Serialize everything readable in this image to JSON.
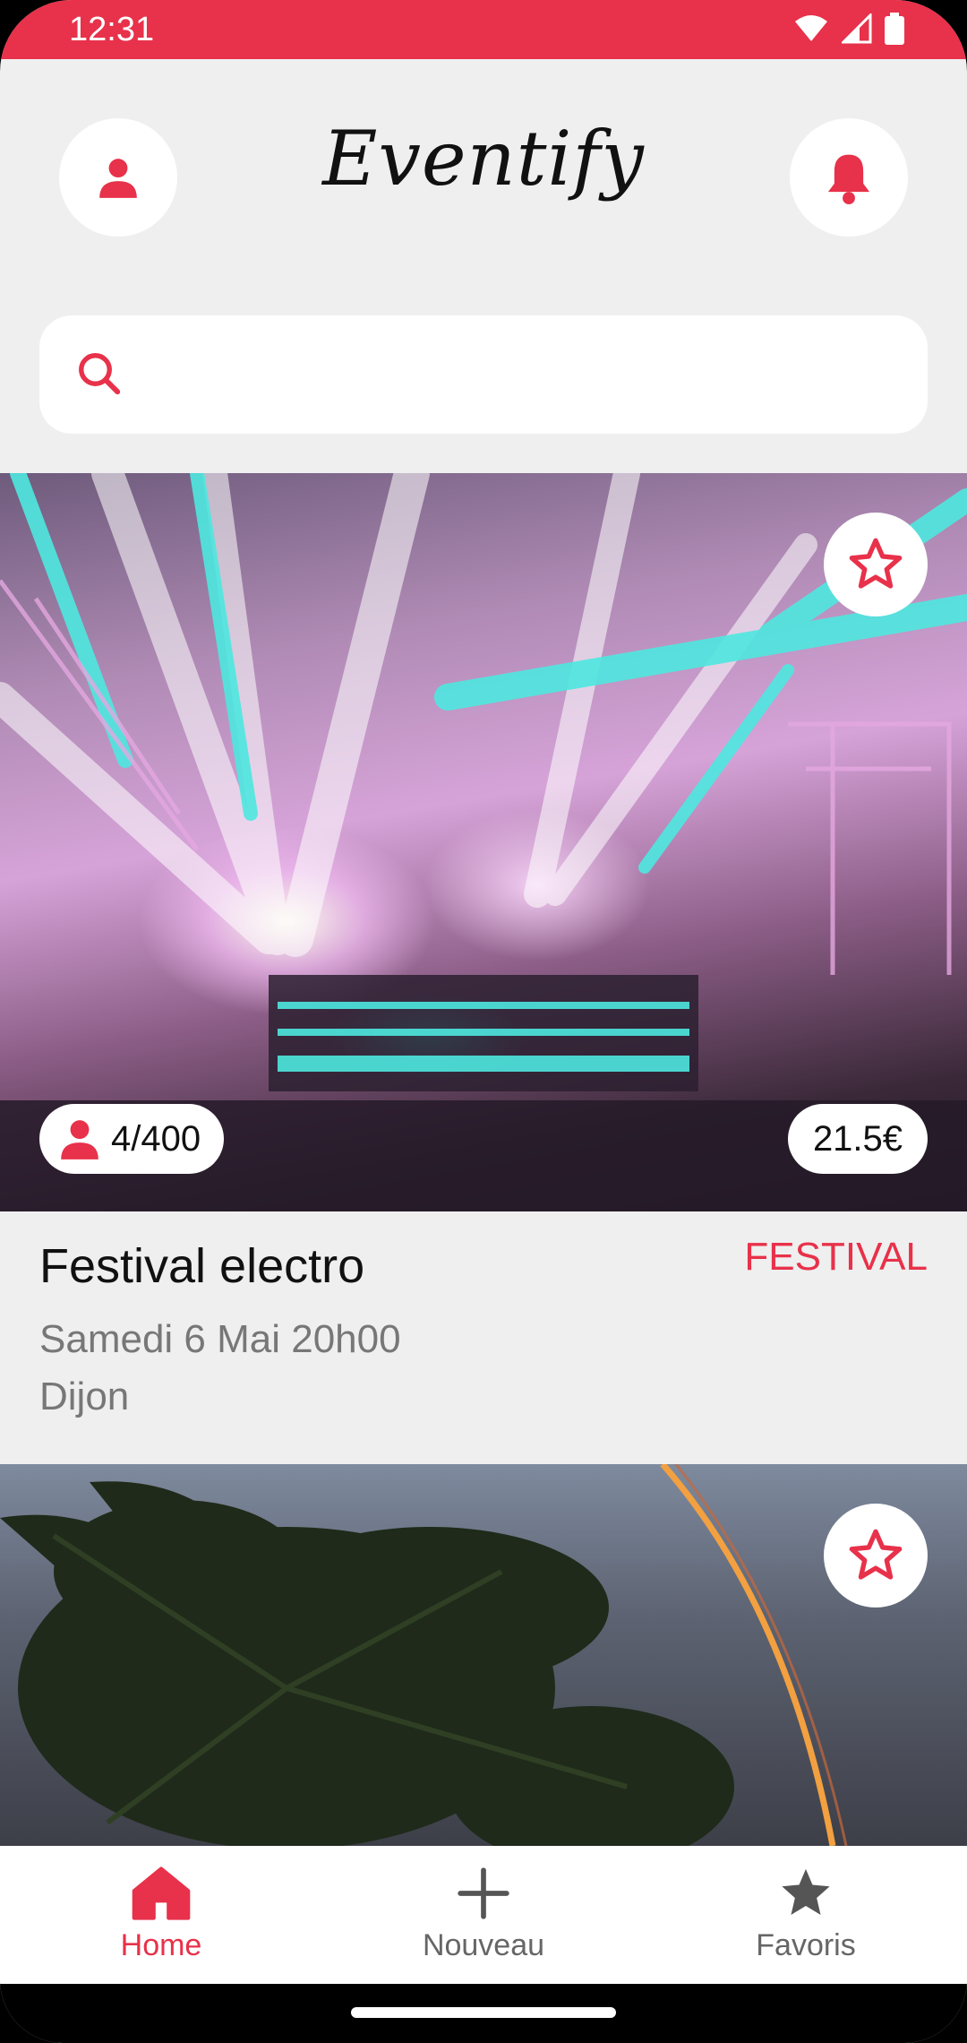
{
  "status_bar": {
    "time": "12:31"
  },
  "header": {
    "app_name": "Eventify"
  },
  "search": {
    "placeholder": ""
  },
  "events": [
    {
      "attendees": "4/400",
      "price": "21.5€",
      "title": "Festival electro",
      "category": "FESTIVAL",
      "date": "Samedi 6 Mai 20h00",
      "city": "Dijon"
    }
  ],
  "bottom_nav": [
    {
      "label": "Home",
      "icon": "home-icon",
      "active": true
    },
    {
      "label": "Nouveau",
      "icon": "plus-icon",
      "active": false
    },
    {
      "label": "Favoris",
      "icon": "star-icon",
      "active": false
    }
  ],
  "colors": {
    "accent": "#e8314a",
    "background": "#efefef"
  }
}
